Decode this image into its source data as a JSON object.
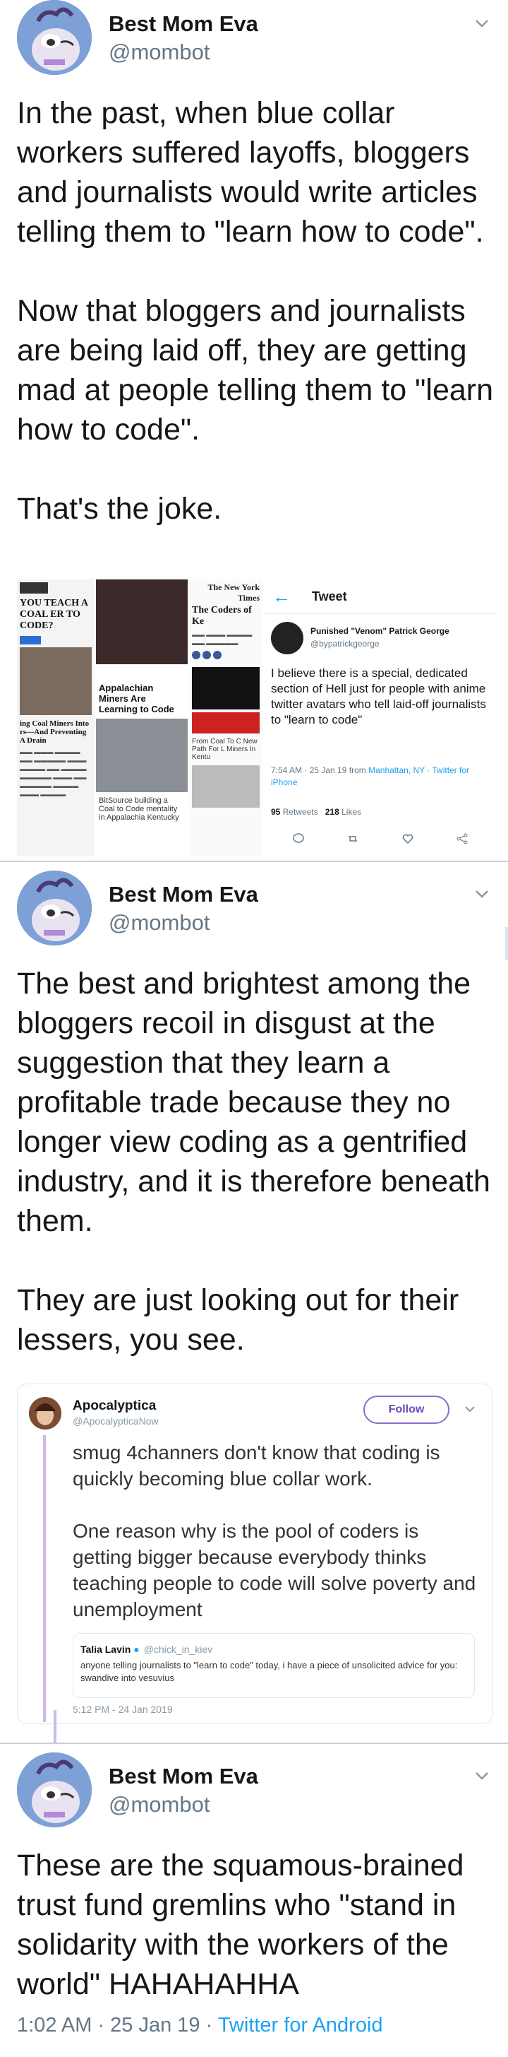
{
  "tweets": [
    {
      "name": "Best Mom Eva",
      "handle": "@mombot",
      "text": "In the past, when blue collar workers suffered layoffs, bloggers and journalists would write articles telling them to \"learn how to code\".\n\nNow that bloggers and journalists are being laid off, they are getting mad at people telling them to \"learn how to code\".\n\nThat's the joke."
    },
    {
      "name": "Best Mom Eva",
      "handle": "@mombot",
      "text": "The best and brightest among the bloggers recoil in disgust at the suggestion that they learn a profitable trade because they no longer view coding as a gentrified industry, and it is therefore beneath them.\n\nThey are just looking out for their lessers, you see."
    },
    {
      "name": "Best Mom Eva",
      "handle": "@mombot",
      "text": "These are the squamous-brained trust fund gremlins who \"stand in solidarity with the workers of the world\" HAHAHAHHA"
    }
  ],
  "collage": {
    "col1_header": "YOU TEACH A COAL ER TO CODE?",
    "col1_story": "ing Coal Miners Into rs—And Preventing A Drain",
    "col2_header": "",
    "col2_story": "Appalachian Miners Are Learning to Code",
    "col2_caption": "BitSource building a Coal to Code mentality in Appalachia Kentucky",
    "col3_masthead": "The New York Times",
    "col3_header": "The Coders of Ke",
    "col3_story": "From Coal To C New Path For L Miners In Kentu",
    "tweet_header": "Tweet",
    "tweet_author": "Punished \"Venom\" Patrick George",
    "tweet_handle": "@bypatrickgeorge",
    "tweet_text": "I believe there is a special, dedicated section of Hell just for people with anime twitter avatars who tell laid-off journalists to \"learn to code\"",
    "tweet_time": "7:54 AM · 25 Jan 19 from",
    "tweet_location": "Manhattan, NY",
    "tweet_source": "Twitter for iPhone",
    "retweets_count": "95",
    "retweets_label": "Retweets",
    "likes_count": "218",
    "likes_label": "Likes"
  },
  "quote": {
    "name": "Apocalyptica",
    "handle": "@ApocalypticaNow",
    "follow_label": "Follow",
    "text": "smug 4channers don't know that coding is quickly becoming blue collar work.\n\nOne reason why is the pool of coders is getting bigger because everybody thinks teaching people to code will solve poverty and unemployment",
    "inner_name": "Talia Lavin",
    "inner_handle": "@chick_in_kiev",
    "inner_text": "anyone telling journalists to \"learn to code\" today, i have a piece of unsolicited advice for you: swandive into vesuvius",
    "time": "5:12 PM - 24 Jan 2019"
  },
  "footer": {
    "time": "1:02 AM · 25 Jan 19 · ",
    "source": "Twitter for Android"
  },
  "colors": {
    "link": "#1da1f2",
    "secondary_text": "#657786",
    "follow_accent": "#8b6ccf",
    "thread_line": "#cdb8ee"
  }
}
